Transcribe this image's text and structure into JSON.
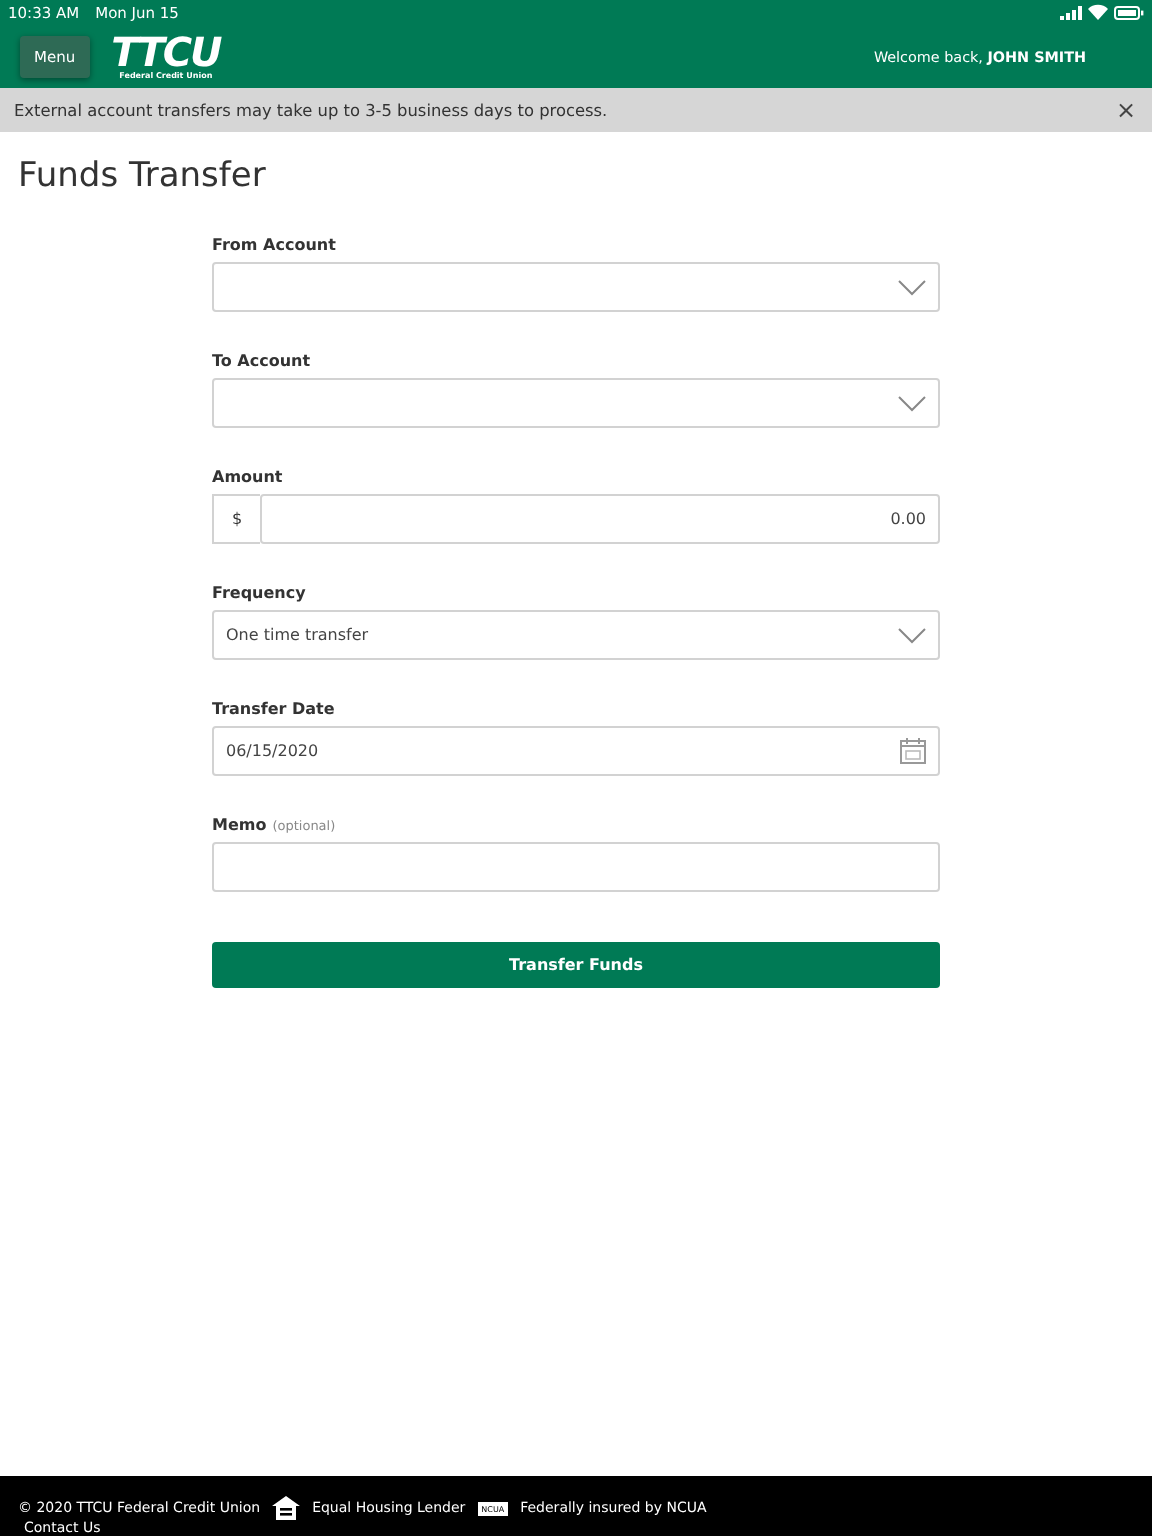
{
  "status_bar": {
    "time": "10:33 AM",
    "date": "Mon Jun 15"
  },
  "header": {
    "menu_button": "Menu",
    "logo": {
      "text": "TTCU",
      "subtitle": "Federal Credit Union"
    },
    "welcome": "Welcome back, **JOHN SMITH**"
  },
  "banner": {
    "message": "External account transfers may take up to 3-5 business days to process.",
    "close": "×"
  },
  "page_title": "Funds Transfer",
  "fields": [
    {
      "kind": "select",
      "label": "From Account"
    },
    {
      "kind": "select",
      "label": "To Account"
    },
    {
      "kind": "amount",
      "label": "Amount",
      "prefix": "$",
      "value": "0.00"
    },
    {
      "kind": "select",
      "label": "Frequency",
      "value": "One time transfer"
    },
    {
      "kind": "date",
      "label": "Transfer Date",
      "value": "06/15/2020"
    },
    {
      "kind": "text",
      "label": "Memo",
      "hint": "(optional)"
    }
  ],
  "submit_button": "Transfer Funds",
  "footer": {
    "copyright": "© 2020 TTCU Federal Credit Union",
    "housing": "Equal Housing Lender",
    "ncua_badge": "NCUA",
    "insured": "Federally insured by NCUA",
    "contact_link": "Contact Us"
  }
}
